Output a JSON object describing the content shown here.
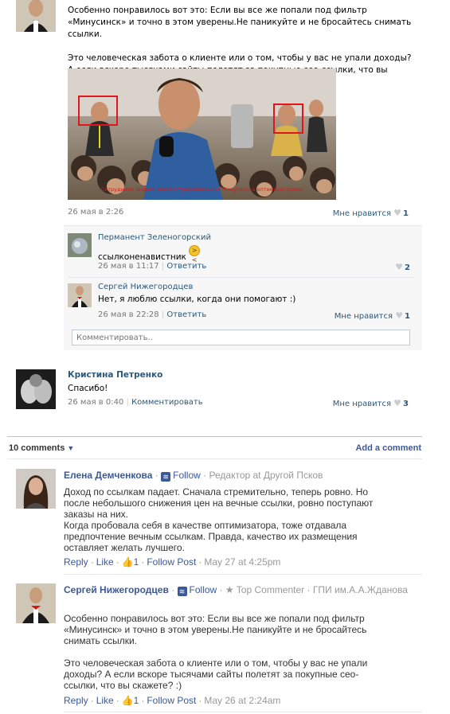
{
  "post": {
    "text": "Особенно понравилось вот это: Если вы все же попали под фильтр «Минусинск» и точно в этом уверены.Не паникуйте и не бросайтесь снимать ссылки.",
    "text2": "Это человеческая забота о клиенте или о том, чтобы у вас не упали доходы? А если вскоре тысячами сайты полетят за покупные сео-ссылки, что вы скажете? :)",
    "photo_caption": "Сотрудники Яндекс над пострадавшими от Минусинска оптимизаторами",
    "date": "26 мая в 2:26",
    "like_label": "Мне нравится",
    "likes": "1"
  },
  "replies": [
    {
      "name": "Перманент Зеленогорский",
      "text": "ссылконенавистник",
      "date": "26 мая в 11:17",
      "reply_label": "Ответить",
      "likes": "2"
    },
    {
      "name": "Сергей Нижегородцев",
      "text": "Нет, я люблю ссылки, когда они помогают :)",
      "date": "26 мая в 22:28",
      "reply_label": "Ответить",
      "like_label": "Мне нравится",
      "likes": "1"
    }
  ],
  "comment_placeholder": "Комментировать..",
  "comment2": {
    "name": "Кристина Петренко",
    "text": "Спасибо!",
    "date": "26 мая в 0:40",
    "comment_label": "Комментировать",
    "like_label": "Мне нравится",
    "likes": "3"
  },
  "fb": {
    "count_label": "10 comments",
    "add_label": "Add a comment",
    "comments": [
      {
        "name": "Елена Демченкова",
        "follow": "Follow",
        "role": "Редактор at Другой Псков",
        "body": [
          "Доход по ссылкам падает. Сначала стремительно, теперь ровно. Но",
          "после небольшого снижения цен на вечные ссылки, ровно поступают",
          "заказы на них.",
          "Когда пробовала себя в качестве оптимизатора, тоже отдавала",
          "предпочтение вечным ссылкам. Правда, качество их размещения",
          "оставляет желать лучшего."
        ],
        "reply": "Reply",
        "like": "Like",
        "likes": "1",
        "follow_post": "Follow Post",
        "date": "May 27 at 4:25pm"
      },
      {
        "name": "Сергей Нижегородцев",
        "follow": "Follow",
        "badge": "Top Commenter",
        "role": "ГПИ им.А.А.Жданова",
        "body": [
          "Особенно понравилось вот это: Если вы все же попали под фильтр",
          "«Минусинск» и точно в этом уверены.Не паникуйте и не бросайтесь",
          "снимать ссылки.",
          "",
          "Это человеческая забота о клиенте или о том, чтобы у вас не упали",
          "доходы? А если вскоре тысячами сайты полетят за покупные сео-",
          "ссылки, что вы скажете? :)"
        ],
        "reply": "Reply",
        "like": "Like",
        "likes": "1",
        "follow_post": "Follow Post",
        "date": "May 26 at 2:24am"
      }
    ]
  },
  "colors": {
    "vk_link": "#2b587a",
    "fb_link": "#3b5998",
    "highlight_box": "#e0161b"
  }
}
